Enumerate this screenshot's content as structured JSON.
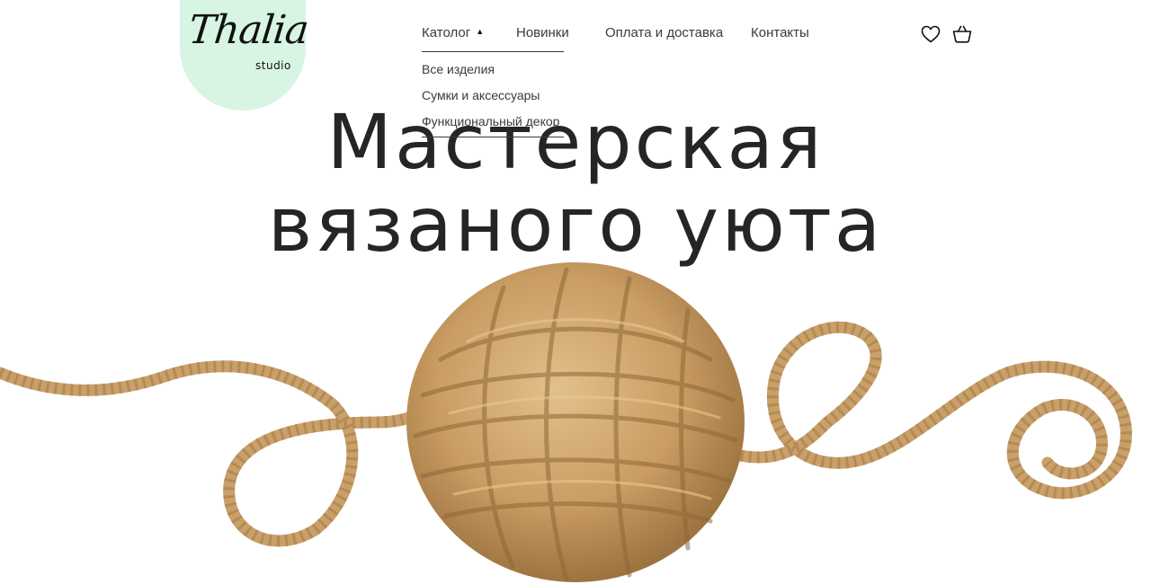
{
  "logo": {
    "script": "Thalia",
    "sub": "studio",
    "bg_color": "#d7f5e2"
  },
  "nav": {
    "catalog": "Католог",
    "new": "Новинки",
    "pay": "Оплата и доставка",
    "contacts": "Контакты"
  },
  "dropdown": {
    "items": [
      {
        "label": "Все изделия"
      },
      {
        "label": "Сумки и аксессуары"
      },
      {
        "label": "Функциональный декор"
      }
    ]
  },
  "icons": {
    "favorites": "heart-icon",
    "cart": "basket-icon"
  },
  "hero": {
    "line1": "Мастерская",
    "line2": "вязаного уюта"
  },
  "colors": {
    "rope": "#c9a06a",
    "text": "#252525"
  }
}
